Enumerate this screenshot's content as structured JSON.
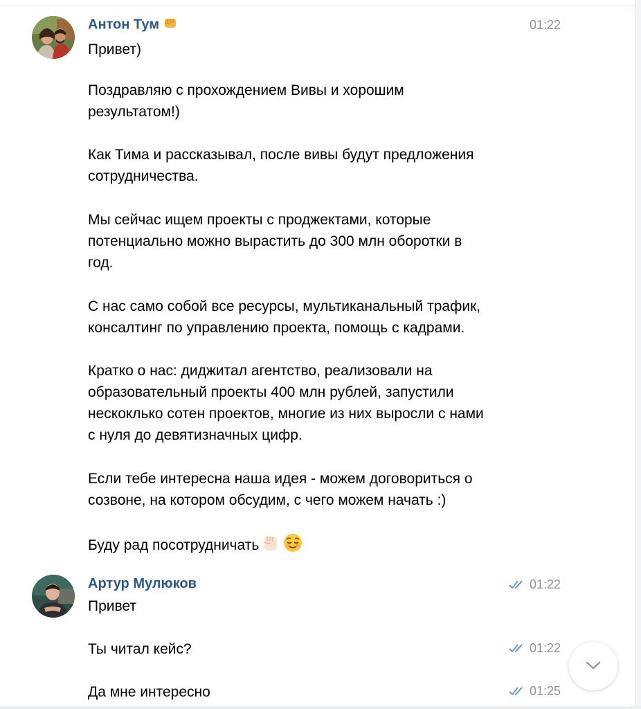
{
  "messages": [
    {
      "sender": "Антон Тум",
      "sender_emoji": "fist-emoji",
      "time": "01:22",
      "paragraphs": [
        "Привет)",
        "Поздравляю с прохождением Вивы и хорошим\nрезультатом!)",
        "Как Тима и рассказывал, после вивы будут предложения\nсотрудничества.",
        "Мы сейчас ищем проекты с проджектами, которые\nпотенциально можно вырастить до 300 млн оборотки в\nгод.",
        "С нас само собой все ресурсы, мультиканальный трафик,\nконсалтинг по управлению проекта, помощь с кадрами.",
        "Кратко о нас: диджитал агентство, реализовали на\nобразовательный проекты 400 млн рублей, запустили\nнескоклько сотен проектов, многие из них выросли с нами\nс нуля до девятизначных цифр.",
        "Если тебе интересна наша идея - можем договориться о\nсозвоне, на котором обсудим, с чего можем начать :)",
        "Буду рад посотрудничать"
      ]
    },
    {
      "sender": "Артур Мулюков",
      "lines": [
        {
          "text": "Привет",
          "time": "01:22",
          "status": "read"
        },
        {
          "text": "Ты читал кейс?",
          "time": "01:22",
          "status": "read"
        },
        {
          "text": "Да мне интересно",
          "time": "01:25",
          "status": "read"
        }
      ]
    }
  ],
  "icons": {
    "read_checks": "double-check-icon",
    "scroll_down": "chevron-down-icon"
  },
  "colors": {
    "sender_name": "#2a5885",
    "timestamp": "#939393",
    "read_checks": "#5c8fc4"
  }
}
